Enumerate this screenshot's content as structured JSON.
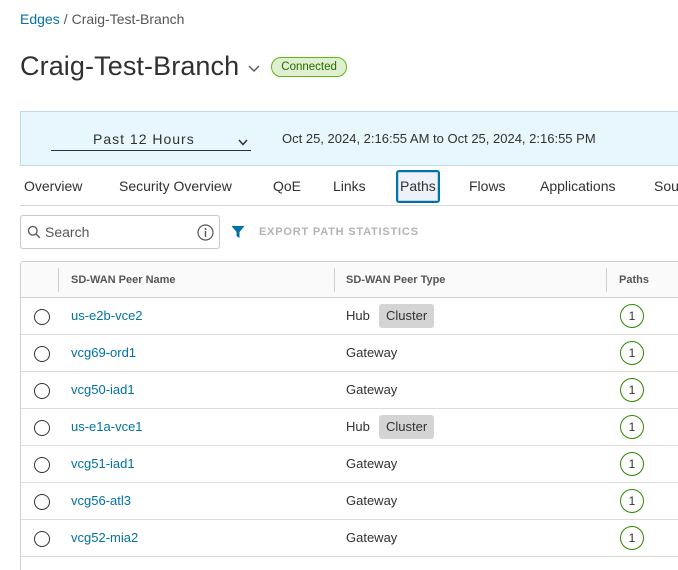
{
  "breadcrumb": {
    "root": "Edges",
    "separator": "/",
    "current": "Craig-Test-Branch"
  },
  "header": {
    "title": "Craig-Test-Branch",
    "status": "Connected"
  },
  "time_filter": {
    "selected": "Past 12 Hours",
    "range": "Oct 25, 2024, 2:16:55 AM to Oct 25, 2024, 2:16:55 PM"
  },
  "tabs": [
    {
      "label": "Overview"
    },
    {
      "label": "Security Overview"
    },
    {
      "label": "QoE"
    },
    {
      "label": "Links"
    },
    {
      "label": "Paths",
      "active": true
    },
    {
      "label": "Flows"
    },
    {
      "label": "Applications"
    },
    {
      "label": "Sou"
    }
  ],
  "toolbar": {
    "search_placeholder": "Search",
    "export_label": "EXPORT PATH STATISTICS"
  },
  "table": {
    "columns": [
      "SD-WAN Peer Name",
      "SD-WAN Peer Type",
      "Paths"
    ],
    "rows": [
      {
        "name": "us-e2b-vce2",
        "type": "Hub",
        "badge": "Cluster",
        "paths": "1"
      },
      {
        "name": "vcg69-ord1",
        "type": "Gateway",
        "badge": "",
        "paths": "1"
      },
      {
        "name": "vcg50-iad1",
        "type": "Gateway",
        "badge": "",
        "paths": "1"
      },
      {
        "name": "us-e1a-vce1",
        "type": "Hub",
        "badge": "Cluster",
        "paths": "1"
      },
      {
        "name": "vcg51-iad1",
        "type": "Gateway",
        "badge": "",
        "paths": "1"
      },
      {
        "name": "vcg56-atl3",
        "type": "Gateway",
        "badge": "",
        "paths": "1"
      },
      {
        "name": "vcg52-mia2",
        "type": "Gateway",
        "badge": "",
        "paths": "1"
      }
    ]
  },
  "colors": {
    "link": "#0072a3",
    "status_border": "#5eb715",
    "status_bg": "#dff0d0",
    "paths_circle": "#318700",
    "time_bar_bg": "#e8f6fd"
  }
}
